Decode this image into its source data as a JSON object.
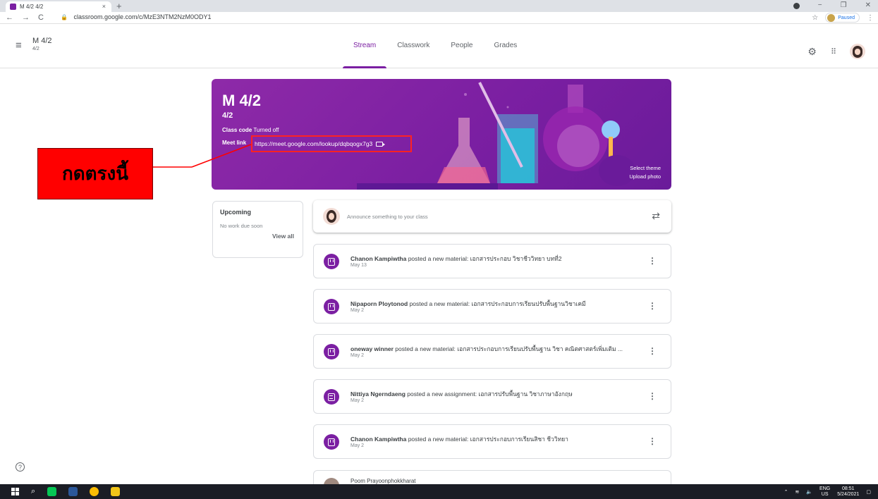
{
  "browser": {
    "tab_title": "M 4/2 4/2",
    "tab_close": "×",
    "new_tab": "+",
    "url": "classroom.google.com/c/MzE3NTM2NzM0ODY1",
    "paused_label": "Paused",
    "window_controls": [
      "−",
      "❐",
      "✕"
    ]
  },
  "header": {
    "menu_icon": "≡",
    "class_title": "M 4/2",
    "class_subtitle": "4/2",
    "tabs": [
      {
        "label": "Stream",
        "active": true
      },
      {
        "label": "Classwork",
        "active": false
      },
      {
        "label": "People",
        "active": false
      },
      {
        "label": "Grades",
        "active": false
      }
    ],
    "settings_icon": "⚙",
    "apps_icon": "⋮⋮⋮"
  },
  "banner": {
    "title": "M 4/2",
    "subtitle": "4/2",
    "class_code_label": "Class code",
    "class_code_value": "Turned off",
    "meet_link_label": "Meet link",
    "meet_link_url": "https://meet.google.com/lookup/dqbqogx7g3",
    "select_theme": "Select theme",
    "upload_photo": "Upload photo",
    "background_color": "#7b1fa2"
  },
  "callout": {
    "text": "กดตรงนี้",
    "color": "#ff0000"
  },
  "upcoming": {
    "heading": "Upcoming",
    "status": "No work due soon",
    "view_all": "View all"
  },
  "announce": {
    "placeholder": "Announce something to your class",
    "repost_icon": "⇄"
  },
  "posts": [
    {
      "author": "Chanon Kampiwtha",
      "action": " posted a new material: ",
      "title": "เอกสารประกอบ วิชาชีววิทยา บทที่2",
      "date": "May 13",
      "kind": "material",
      "more": "⋮"
    },
    {
      "author": "Nipaporn Ploytonod",
      "action": " posted a new material: ",
      "title": "เอกสารประกอบการเรียนปรับพื้นฐานวิชาเคมี",
      "date": "May 2",
      "kind": "material",
      "more": "⋮"
    },
    {
      "author": "oneway winner",
      "action": " posted a new material: ",
      "title": "เอกสารประกอบการเรียนปรับพื้นฐาน วิชา คณิตศาสตร์เพิ่มเติม ...",
      "date": "May 2",
      "kind": "material",
      "more": "⋮"
    },
    {
      "author": "Nittiya Ngerndaeng",
      "action": " posted a new assignment: ",
      "title": "เอกสารปรับพื้นฐาน วิชาภาษาอังกฤษ",
      "date": "May 2",
      "kind": "assignment",
      "more": "⋮"
    },
    {
      "author": "Chanon Kampiwtha",
      "action": " posted a new material: ",
      "title": "เอกสารประกอบการเรียนสิชา ชีววิทยา",
      "date": "May 2",
      "kind": "material",
      "more": "⋮"
    }
  ],
  "peek_post": {
    "author": "Poom Prayoonphokkharat"
  },
  "help_icon": "?",
  "taskbar": {
    "lang_top": "ENG",
    "lang_bottom": "US",
    "time": "08:51",
    "date": "5/24/2021"
  }
}
